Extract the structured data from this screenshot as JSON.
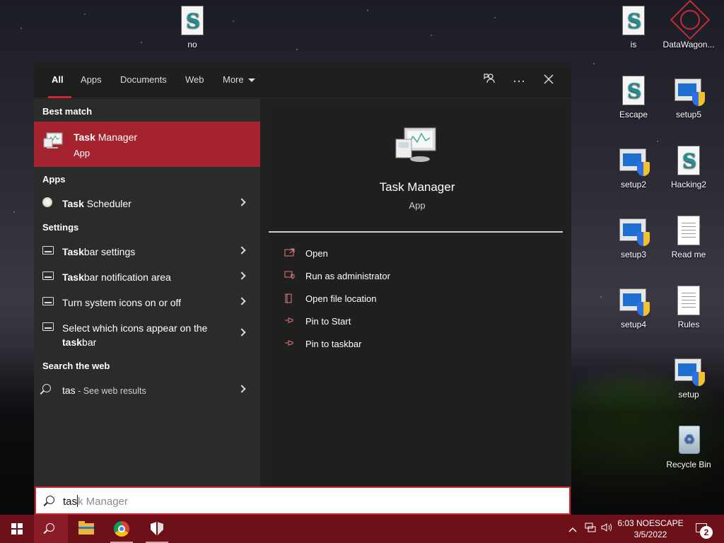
{
  "desktop": {
    "icons": [
      {
        "label": "no",
        "kind": "script-icon"
      },
      {
        "label": "is",
        "kind": "script-icon"
      },
      {
        "label": "DataWagon...",
        "kind": "logo-icon"
      },
      {
        "label": "Escape",
        "kind": "script-icon"
      },
      {
        "label": "setup5",
        "kind": "installer-icon"
      },
      {
        "label": "setup2",
        "kind": "installer-icon"
      },
      {
        "label": "Hacking2",
        "kind": "script-icon"
      },
      {
        "label": "setup3",
        "kind": "installer-icon"
      },
      {
        "label": "Read me",
        "kind": "text-document-icon"
      },
      {
        "label": "setup4",
        "kind": "installer-icon"
      },
      {
        "label": "Rules",
        "kind": "text-document-icon"
      },
      {
        "label": "setup",
        "kind": "installer-icon"
      },
      {
        "label": "Recycle Bin",
        "kind": "recycle-bin-icon"
      }
    ]
  },
  "search": {
    "tabs": [
      {
        "label": "All",
        "active": true
      },
      {
        "label": "Apps"
      },
      {
        "label": "Documents"
      },
      {
        "label": "Web"
      },
      {
        "label": "More"
      }
    ],
    "sections": {
      "best_match": "Best match",
      "apps": "Apps",
      "settings": "Settings",
      "web": "Search the web"
    },
    "best_match": {
      "bold": "Task",
      "rest": " Manager",
      "sub": "App"
    },
    "apps": [
      {
        "bold": "Task",
        "rest": " Scheduler"
      }
    ],
    "settings": [
      {
        "bold": "Task",
        "rest": "bar settings"
      },
      {
        "bold": "Task",
        "rest": "bar notification area"
      },
      {
        "plain": "Turn system icons on or off"
      },
      {
        "line1": "Select which icons appear on the",
        "bold2": "task",
        "rest2": "bar"
      }
    ],
    "web": {
      "query": "tas",
      "suffix": " - See web results"
    },
    "preview": {
      "title": "Task Manager",
      "subtitle": "App",
      "actions": [
        {
          "label": "Open",
          "icon": "open-icon"
        },
        {
          "label": "Run as administrator",
          "icon": "shield-icon"
        },
        {
          "label": "Open file location",
          "icon": "folder-icon"
        },
        {
          "label": "Pin to Start",
          "icon": "pin-icon"
        },
        {
          "label": "Pin to taskbar",
          "icon": "pin-icon"
        }
      ]
    },
    "box": {
      "typed": "tas",
      "completion": "k Manager"
    }
  },
  "taskbar": {
    "clock_time": "6:03 NOESCAPE",
    "clock_date": "3/5/2022",
    "notification_count": "2",
    "accent": "#6e1018"
  }
}
